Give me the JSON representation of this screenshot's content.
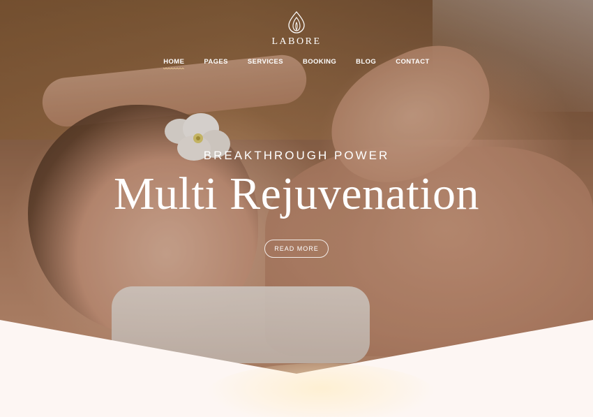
{
  "brand": {
    "name": "LABORE",
    "logo_icon": "lotus-drop-icon"
  },
  "nav": {
    "items": [
      {
        "label": "HOME",
        "active": true
      },
      {
        "label": "PAGES",
        "active": false
      },
      {
        "label": "SERVICES",
        "active": false
      },
      {
        "label": "BOOKING",
        "active": false
      },
      {
        "label": "BLOG",
        "active": false
      },
      {
        "label": "CONTACT",
        "active": false
      }
    ]
  },
  "hero": {
    "kicker": "BREAKTHROUGH POWER",
    "headline": "Multi Rejuvenation",
    "cta_label": "READ MORE"
  },
  "colors": {
    "text": "#ffffff",
    "section_background": "#fdf6f3",
    "nav_underline": "#f2d39a"
  }
}
